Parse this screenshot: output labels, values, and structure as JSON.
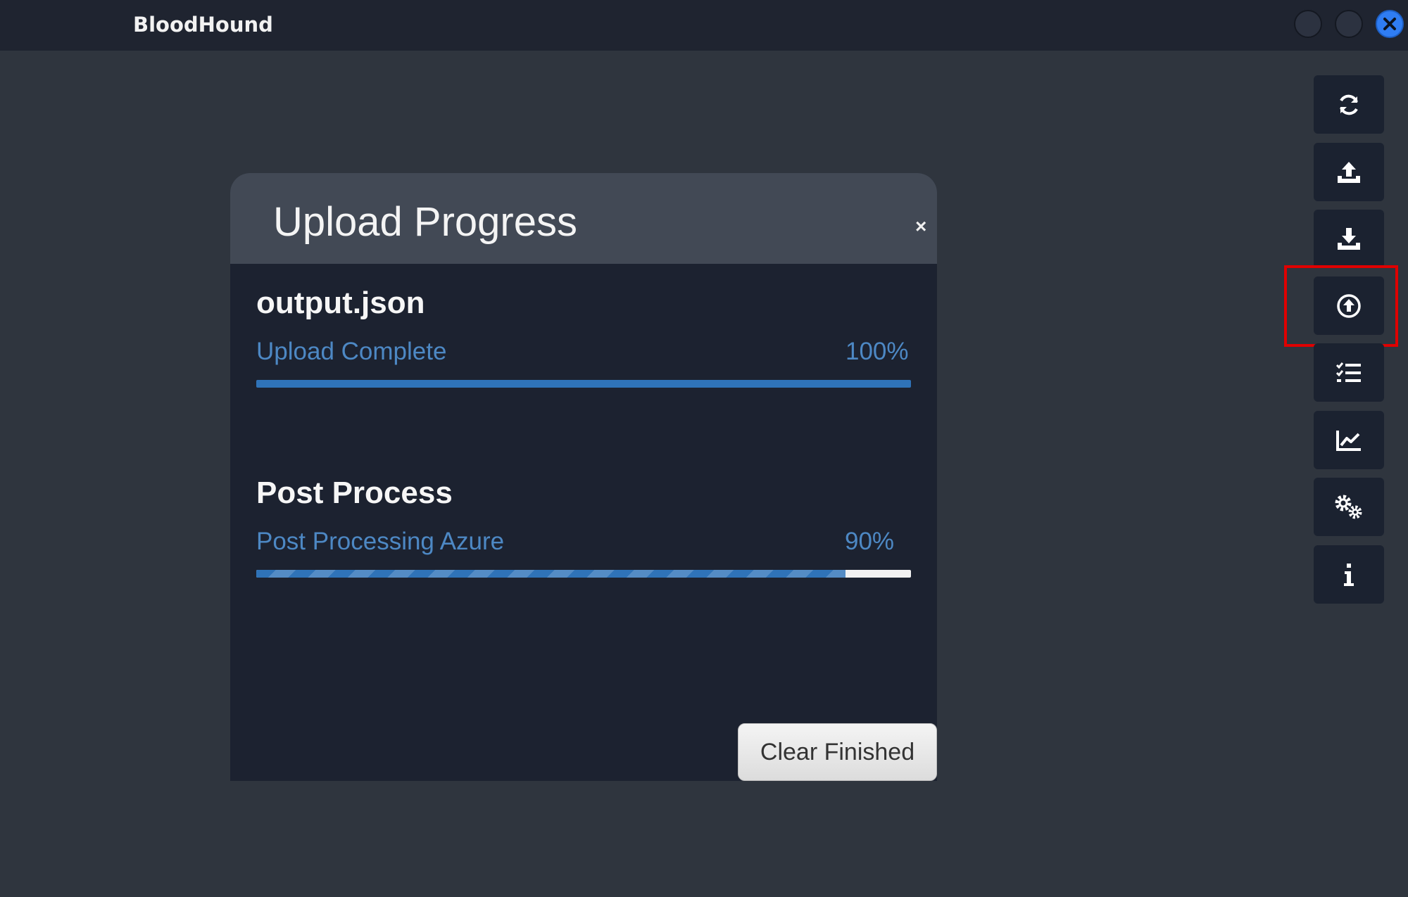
{
  "window": {
    "title": "BloodHound"
  },
  "sidebar": {
    "buttons": [
      {
        "name": "refresh",
        "icon": "refresh-icon"
      },
      {
        "name": "export",
        "icon": "upload-tray-icon"
      },
      {
        "name": "import",
        "icon": "download-tray-icon"
      },
      {
        "name": "upload-data",
        "icon": "circle-arrow-up-icon",
        "highlighted": true
      },
      {
        "name": "queries",
        "icon": "checklist-icon"
      },
      {
        "name": "database-info",
        "icon": "line-chart-icon"
      },
      {
        "name": "settings",
        "icon": "gears-icon"
      },
      {
        "name": "about",
        "icon": "info-icon"
      }
    ],
    "highlight_color": "#e00000"
  },
  "modal": {
    "title": "Upload Progress",
    "close_label": "×",
    "tasks": [
      {
        "name": "output.json",
        "status": "Upload Complete",
        "percent_label": "100%",
        "progress": 100
      },
      {
        "name": "Post Process",
        "status": "Post Processing Azure",
        "percent_label": "90%",
        "progress": 90
      }
    ],
    "clear_button": "Clear Finished"
  },
  "colors": {
    "accent": "#2f73b8",
    "status_text": "#4d88c4",
    "close_button": "#2f7df3"
  }
}
